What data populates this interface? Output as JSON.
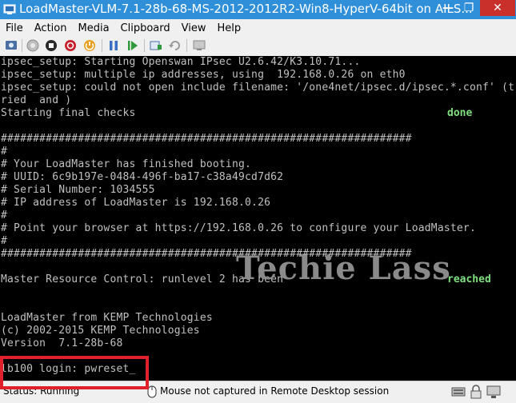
{
  "window": {
    "title": "LoadMaster-VLM-7.1-28b-68-MS-2012-2012R2-Win8-HyperV-64bit on AILS...",
    "minimize_glyph": "—",
    "restore_glyph": "❐",
    "close_glyph": "✕"
  },
  "menu": {
    "items": [
      "File",
      "Action",
      "Media",
      "Clipboard",
      "View",
      "Help"
    ]
  },
  "toolbar": {
    "icons": [
      "ctrl-alt-del-icon",
      "start-icon",
      "turn-off-icon",
      "shut-down-icon",
      "save-icon",
      "pause-icon",
      "reset-icon",
      "checkpoint-icon",
      "revert-icon",
      "enhanced-session-icon"
    ]
  },
  "console": {
    "lines": [
      "ipsec_setup: Starting Openswan IPsec U2.6.42/K3.10.71...",
      "ipsec_setup: multiple ip addresses, using  192.168.0.26 on eth0",
      "ipsec_setup: could not open include filename: '/one4net/ipsec.d/ipsec.*.conf' (t",
      "ried  and )",
      "Starting final checks",
      "",
      "################################################################",
      "#",
      "# Your LoadMaster has finished booting.",
      "# UUID: 6c9b197e-0484-496f-ba17-c38a49cd7d62",
      "# Serial Number: 1034555",
      "# IP address of LoadMaster is 192.168.0.26",
      "#",
      "# Point your browser at https://192.168.0.26 to configure your LoadMaster.",
      "#",
      "################################################################",
      "",
      "Master Resource Control: runlevel 2 has been",
      "",
      "",
      "LoadMaster from KEMP Technologies",
      "(c) 2002-2015 KEMP Technologies",
      "Version  7.1-28b-68",
      "",
      "lb100 login: pwreset_"
    ],
    "status_done": "done",
    "status_reached": "reached"
  },
  "watermark": "Techie Lass",
  "statusbar": {
    "status": "Status: Running",
    "mouse": "Mouse not captured in Remote Desktop session"
  },
  "colors": {
    "titlebar": "#2f8fd8",
    "console_bg": "#000000",
    "console_text": "#c0c0c0",
    "status_green": "#7ee07e",
    "highlight": "#e0202a"
  }
}
